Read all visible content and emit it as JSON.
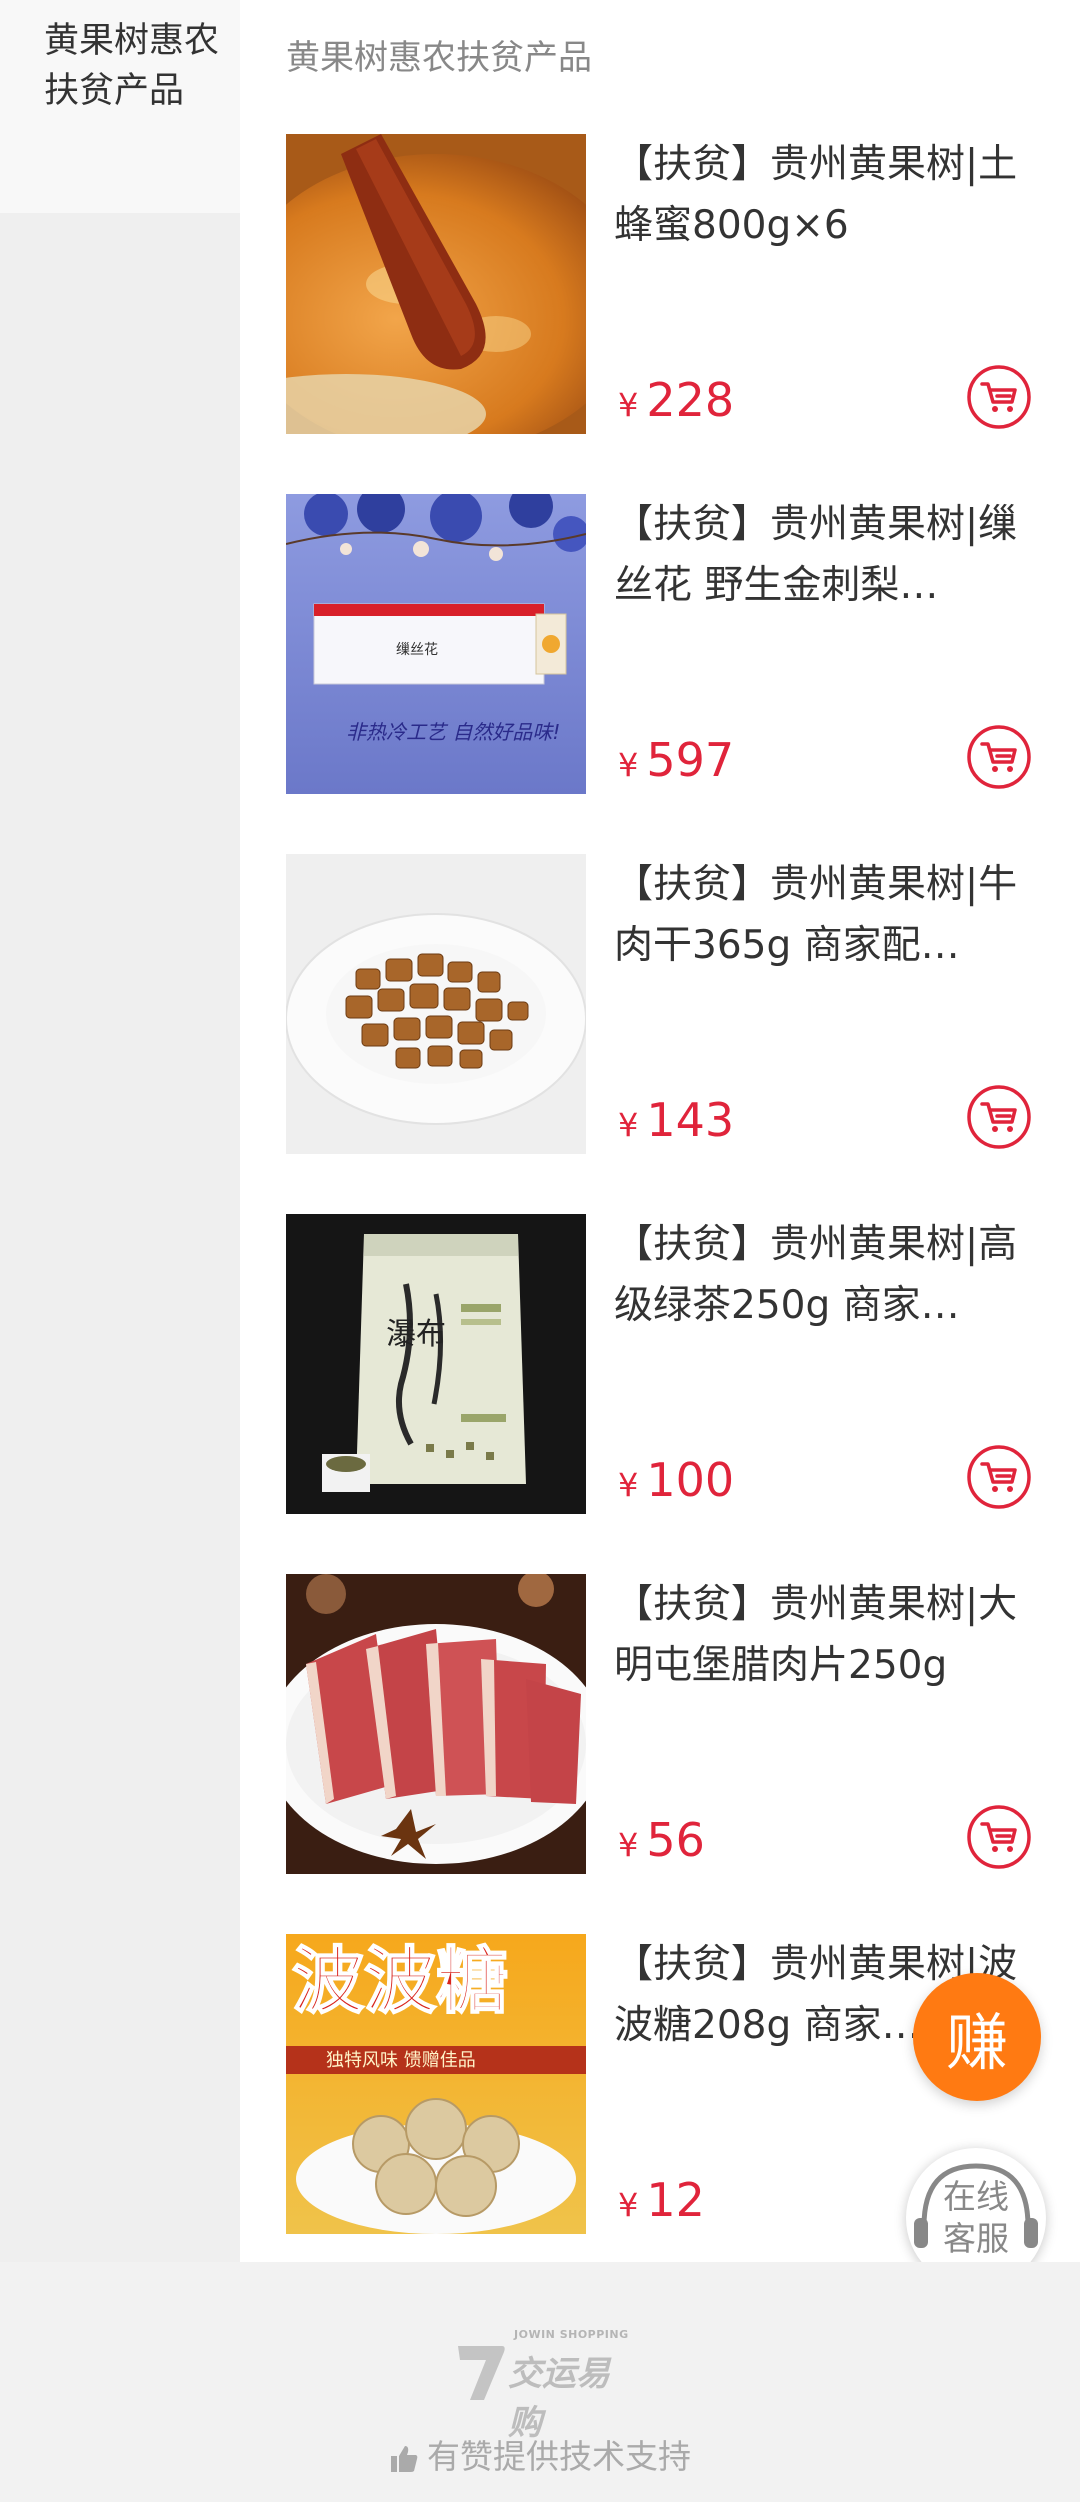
{
  "sidebar": {
    "items": [
      {
        "label": "黄果树惠农扶贫产品"
      }
    ]
  },
  "section": {
    "title": "黄果树惠农扶贫产品"
  },
  "currency_symbol": "¥",
  "products": [
    {
      "name": "【扶贫】贵州黄果树|土蜂蜜800g×6",
      "price": "228",
      "image": "honey-jar"
    },
    {
      "name": "【扶贫】贵州黄果树|缫丝花 野生金刺梨…",
      "price": "597",
      "image": "gift-box"
    },
    {
      "name": "【扶贫】贵州黄果树|牛肉干365g 商家配…",
      "price": "143",
      "image": "beef-jerky"
    },
    {
      "name": "【扶贫】贵州黄果树|高级绿茶250g 商家…",
      "price": "100",
      "image": "tea-bag"
    },
    {
      "name": "【扶贫】贵州黄果树|大明屯堡腊肉片250g",
      "price": "56",
      "image": "cured-pork"
    },
    {
      "name": "【扶贫】贵州黄果树|波波糖208g 商家…",
      "price": "12",
      "image": "bobo-candy"
    }
  ],
  "images": {
    "box_text": "非热冷工艺 自然好品味!",
    "box_label": "缫丝花",
    "tea_text": "瀑布",
    "candy_title": "波波糖",
    "candy_sub": "独特风味 馈赠佳品"
  },
  "floating": {
    "earn_label": "赚",
    "service_line1": "在线",
    "service_line2": "客服"
  },
  "footer": {
    "logo_small": "JOWIN SHOPPING",
    "logo_big": "交运易购",
    "support_text": "有赞提供技术支持"
  },
  "colors": {
    "price": "#e0243b",
    "earn": "#ff7a12",
    "sidebar_active_bg": "#f8f8f8",
    "sidebar_bg": "#efefef"
  }
}
